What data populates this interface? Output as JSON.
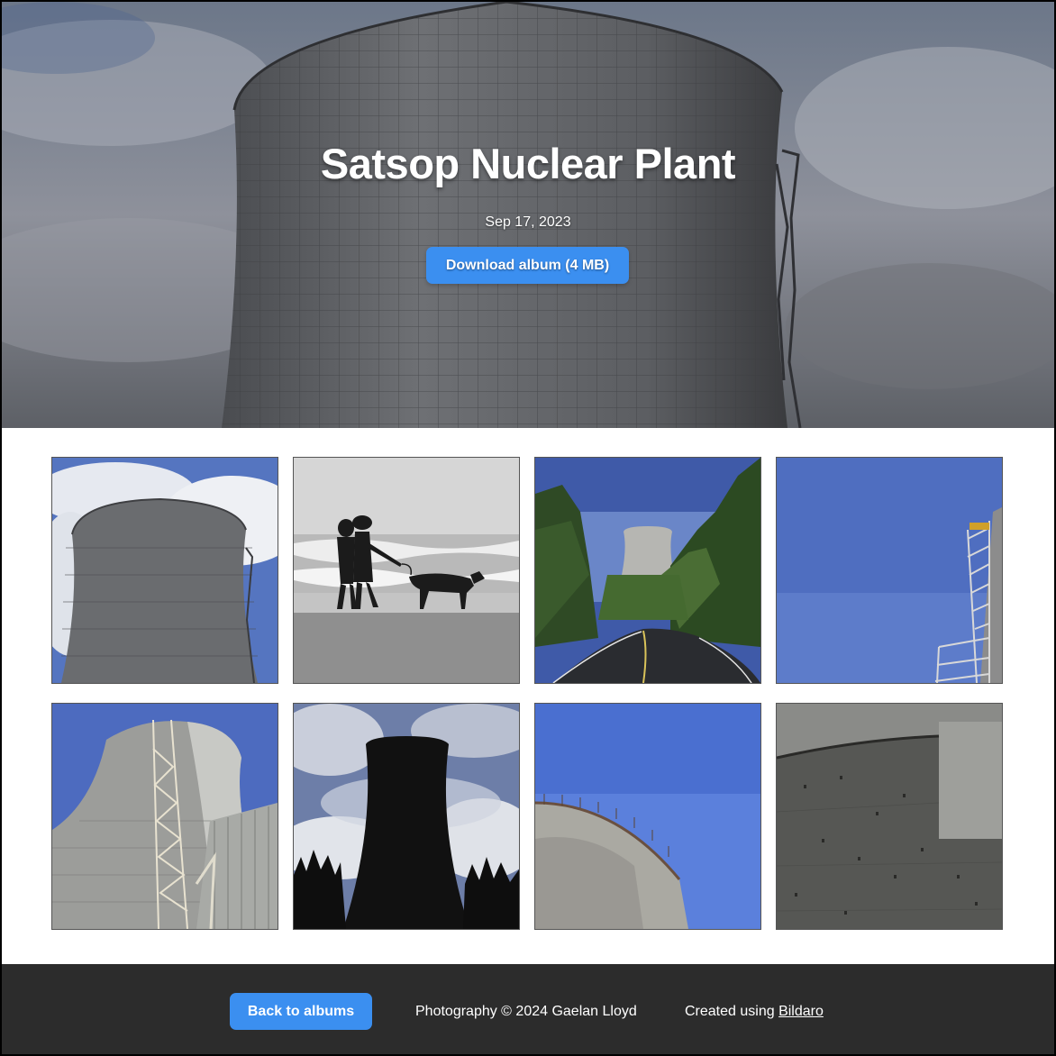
{
  "hero": {
    "title": "Satsop Nuclear Plant",
    "date": "Sep 17, 2023",
    "download_label": "Download album (4 MB)"
  },
  "gallery": {
    "photos": [
      {
        "subject": "cooling-tower-with-clouds"
      },
      {
        "subject": "beach-walk-with-dog"
      },
      {
        "subject": "road-with-tower-in-forest"
      },
      {
        "subject": "steel-stairway-against-sky"
      },
      {
        "subject": "tower-with-ladder-structure"
      },
      {
        "subject": "tower-silhouette"
      },
      {
        "subject": "tower-rim-against-blue-sky"
      },
      {
        "subject": "concrete-wall-closeup"
      }
    ]
  },
  "footer": {
    "back_label": "Back to albums",
    "copyright": "Photography © 2024 Gaelan Lloyd",
    "created_prefix": "Created using",
    "created_link": "Bildaro"
  },
  "colors": {
    "accent": "#3b8ff0",
    "footer_bg": "#2c2c2c"
  }
}
